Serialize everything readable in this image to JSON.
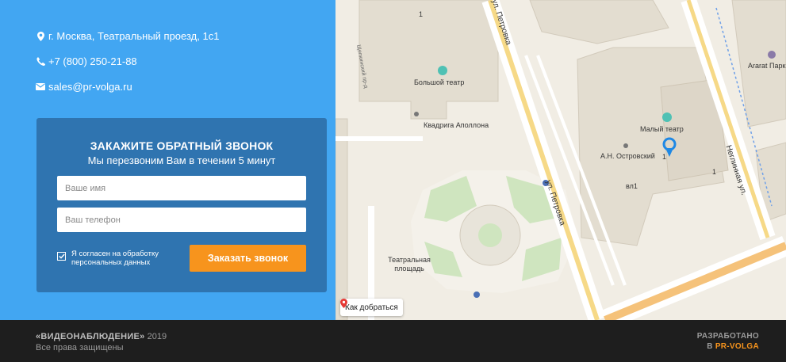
{
  "contacts": {
    "address": "г. Москва, Театральный проезд, 1с1",
    "phone": "+7 (800) 250-21-88",
    "email": "sales@pr-volga.ru"
  },
  "callback_form": {
    "title": "ЗАКАЖИТЕ ОБРАТНЫЙ ЗВОНОК",
    "subtitle": "Мы перезвоним Вам в течении 5 минут",
    "name_placeholder": "Ваше имя",
    "phone_placeholder": "Ваш телефон",
    "consent_text": "Я согласен на обработку персональных данных",
    "consent_checked": true,
    "submit_label": "Заказать звонок"
  },
  "map": {
    "labels": {
      "bolshoi": "Большой театр",
      "kvadriga": "Квадрига Аполлона",
      "maly": "Малый театр",
      "ostrovsky": "А.Н. Островский",
      "vl1": "вл1",
      "square": "Театральная площадь",
      "petrovka": "ул. Петровка",
      "neglinnaya": "Неглинная ул.",
      "ararat": "Ararat Парк",
      "shchepkin": "Щепкинский пр-д",
      "petrovka_top": "ул. Петровка",
      "num1a": "1",
      "num1b": "1",
      "num1c": "1"
    },
    "route_label": "Как добраться"
  },
  "footer": {
    "brand": "«ВИДЕОНАБЛЮДЕНИЕ»",
    "year": "2019",
    "rights": "Все права защищены",
    "dev_label": "РАЗРАБОТАНО",
    "dev_in": "В",
    "dev_name": "PR-VOLGA"
  },
  "colors": {
    "panel_blue": "#42a6f2",
    "card_blue": "#2f74b0",
    "accent_orange": "#f7941d",
    "footer_bg": "#1e1e1e"
  }
}
